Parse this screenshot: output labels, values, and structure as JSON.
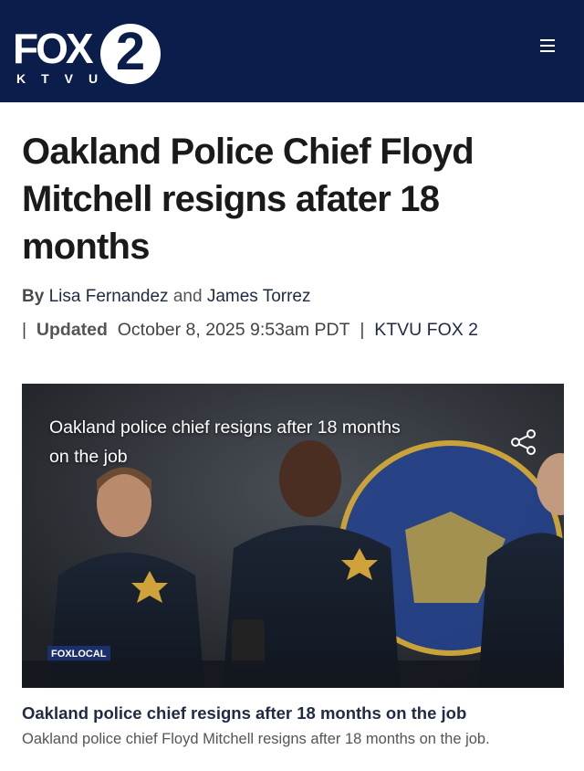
{
  "header": {
    "logo_fox": "FOX",
    "logo_number": "2",
    "logo_call_sign": "KTVU",
    "menu_icon": "hamburger-menu-icon",
    "background": "#0b1d4a"
  },
  "article": {
    "headline": "Oakland Police Chief Floyd Mitchell resigns afater 18 months",
    "by_label": "By",
    "author_1": "Lisa Fernandez",
    "and_label": "and",
    "author_2": "James Torrez",
    "separator": "|",
    "updated_label": "Updated",
    "updated_date": "October 8, 2025 9:53am PDT",
    "source": "KTVU FOX 2"
  },
  "video": {
    "overlay_title": "Oakland police chief resigns after 18 months on the job",
    "share_icon": "share-icon",
    "badge": "FOXLOCAL"
  },
  "caption": {
    "title": "Oakland police chief resigns after 18 months on the job",
    "description": "Oakland police chief Floyd Mitchell resigns after 18 months on the job."
  }
}
